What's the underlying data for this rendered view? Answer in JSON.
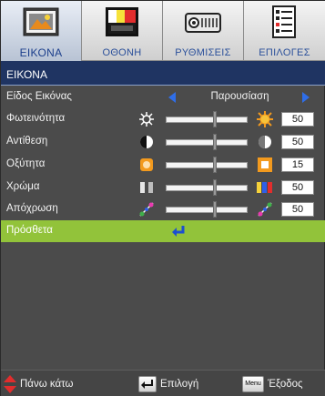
{
  "tabs": [
    {
      "label": "ΕΙΚΟΝΑ",
      "icon": "picture-icon",
      "active": true
    },
    {
      "label": "ΟΘΟΝΗ",
      "icon": "display-icon",
      "active": false
    },
    {
      "label": "ΡΥΘΜΙΣΕΙΣ",
      "icon": "projector-icon",
      "active": false
    },
    {
      "label": "ΕΠΙΛΟΓΕΣ",
      "icon": "options-list-icon",
      "active": false
    }
  ],
  "section": {
    "title": "ΕΙΚΟΝΑ"
  },
  "rows": {
    "mode": {
      "label": "Είδος Εικόνας",
      "value": "Παρουσίαση"
    },
    "brightness": {
      "label": "Φωτεινότητα",
      "value": "50",
      "level_percent": 60
    },
    "contrast": {
      "label": "Αντίθεση",
      "value": "50",
      "level_percent": 60
    },
    "sharpness": {
      "label": "Οξύτητα",
      "value": "15",
      "level_percent": 60
    },
    "color": {
      "label": "Χρώμα",
      "value": "50",
      "level_percent": 60
    },
    "tint": {
      "label": "Απόχρωση",
      "value": "50",
      "level_percent": 60
    },
    "advanced": {
      "label": "Πρόσθετα"
    }
  },
  "footer": {
    "navigate": "Πάνω κάτω",
    "select": "Επιλογή",
    "menu_key": "Menu",
    "exit": "Έξοδος"
  },
  "colors": {
    "tab_label": "#2a4f9a",
    "header_bg": "#1f3462",
    "highlight": "#92c33a",
    "arrow": "#2f6ee8",
    "panel_bg": "#4b4b4b"
  }
}
